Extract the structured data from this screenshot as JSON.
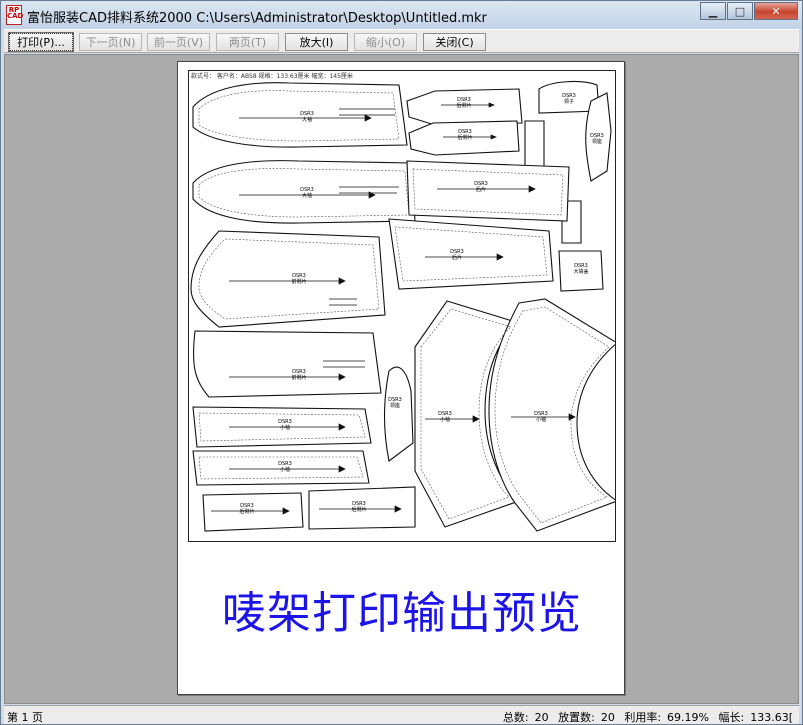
{
  "window": {
    "title": "富怡服装CAD排料系统2000 C:\\Users\\Administrator\\Desktop\\Untitled.mkr",
    "icon_label": "RP CAD",
    "min_glyph": "▁",
    "max_glyph": "□",
    "close_glyph": "✕"
  },
  "toolbar": {
    "print": "打印(P)...",
    "next_page": "下一页(N)",
    "prev_page": "前一页(V)",
    "two_pages": "两页(T)",
    "zoom_in": "放大(I)",
    "zoom_out": "缩小(O)",
    "close": "关闭(C)"
  },
  "preview": {
    "header": "款式号：  客户名：ABS8 规格：133.63厘米 幅宽：145厘米",
    "caption": "唛架打印输出预览",
    "piece_code": "DSR3",
    "piece_names": {
      "big_sleeve": "大袖",
      "back_piece": "后片",
      "front_piece": "前片",
      "back_side": "后侧片",
      "front_side": "前侧片",
      "small_sleeve": "小袖",
      "collar": "领子",
      "collar_stand": "领座",
      "flap": "袋盖",
      "big_flap": "大袋盖",
      "pocket": "袋布"
    }
  },
  "status": {
    "page": "第 1 页",
    "total_label": "总数:",
    "total_value": "20",
    "placed_label": "放置数:",
    "placed_value": "20",
    "utilization_label": "利用率:",
    "utilization_value": "69.19%",
    "width_label": "幅长:",
    "width_value": "133.63["
  }
}
